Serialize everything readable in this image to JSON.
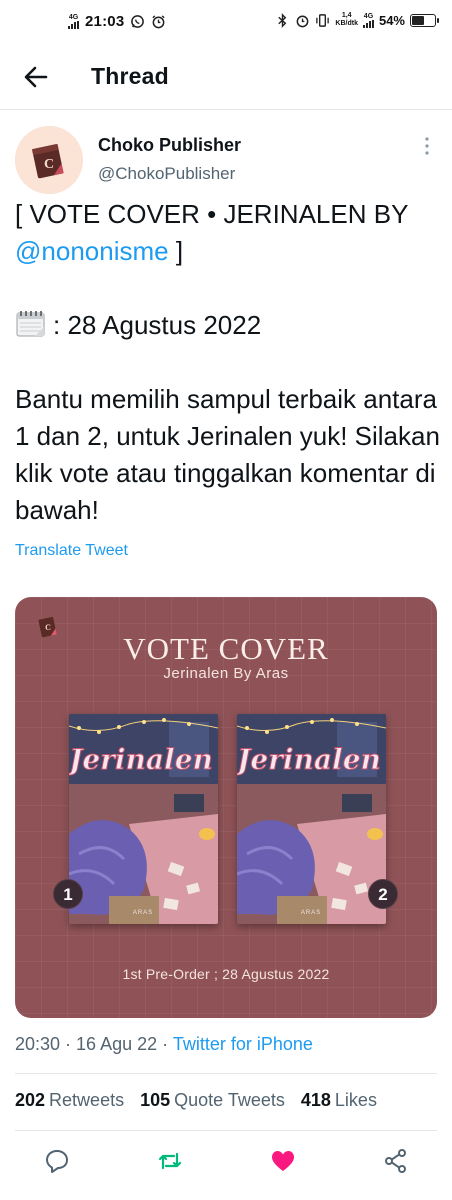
{
  "status_bar": {
    "network": "4G",
    "time": "21:03",
    "speed_value": "1,4",
    "speed_unit": "KB/dtk",
    "network_right": "4G",
    "battery": "54%",
    "battery_level": 0.54
  },
  "header": {
    "title": "Thread"
  },
  "tweet": {
    "author_name": "Choko Publisher",
    "author_handle": "@ChokoPublisher",
    "line1_prefix": "[ VOTE COVER • JERINALEN BY",
    "mention": "@nononisme",
    "line1_suffix": " ]",
    "date_line": ": 28 Agustus 2022",
    "body": "Bantu memilih sampul terbaik antara 1 dan 2, untuk Jerinalen yuk! Silakan klik vote atau tinggalkan komentar di bawah!",
    "translate": "Translate Tweet"
  },
  "media": {
    "title": "VOTE COVER",
    "subtitle": "Jerinalen By Aras",
    "cover_title": "Jerinalen",
    "cover_author": "ARAS",
    "option_1": "1",
    "option_2": "2",
    "preorder": "1st Pre-Order ; 28 Agustus 2022"
  },
  "meta": {
    "time": "20:30",
    "sep1": " · ",
    "date": "16 Agu 22",
    "sep2": " · ",
    "source": "Twitter for iPhone"
  },
  "stats": {
    "retweets_count": "202",
    "retweets_label": "Retweets",
    "quotes_count": "105",
    "quotes_label": "Quote Tweets",
    "likes_count": "418",
    "likes_label": "Likes"
  },
  "colors": {
    "accent": "#1d9bf0",
    "retweet_green": "#00ba7c",
    "like_pink": "#f91880",
    "media_bg": "#8f5357"
  },
  "icons": {
    "back": "arrow-left-icon",
    "more": "more-vertical-icon",
    "reply": "comment-icon",
    "retweet": "retweet-icon",
    "like": "heart-icon",
    "share": "share-icon",
    "calendar": "spiral-calendar-icon"
  }
}
